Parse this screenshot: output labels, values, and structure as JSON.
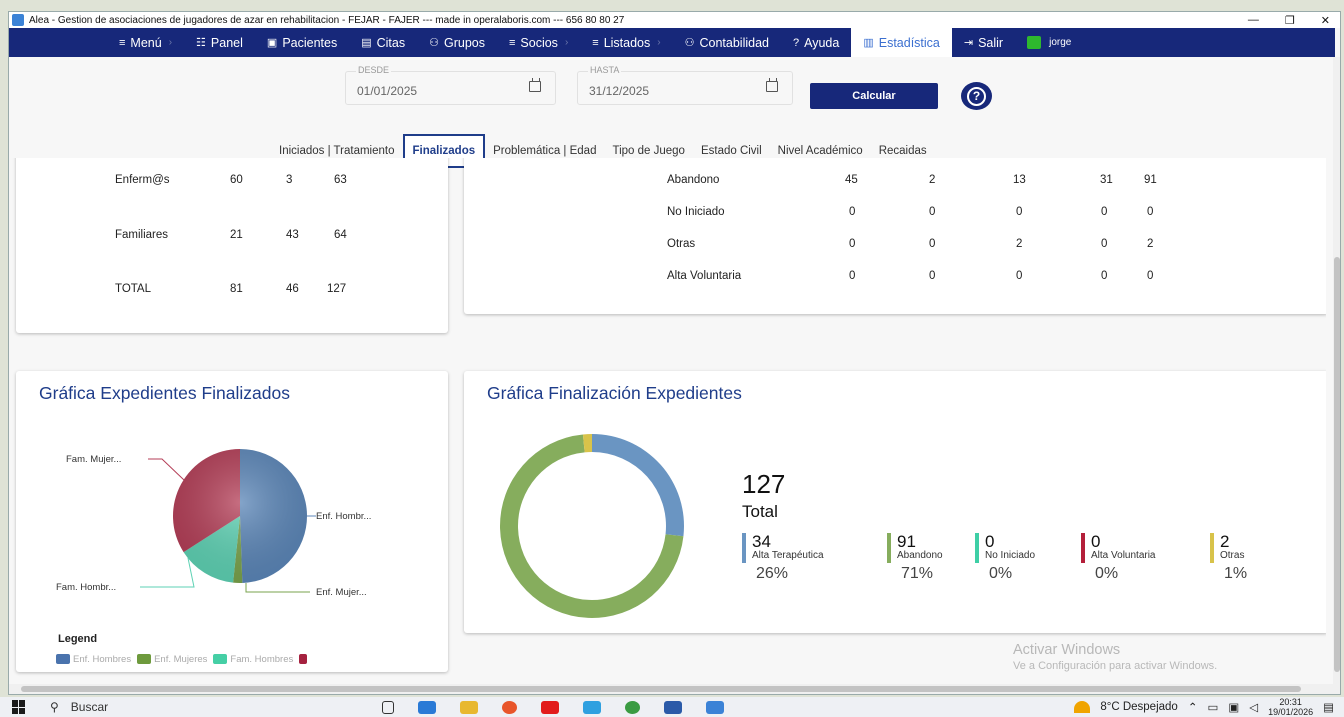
{
  "window": {
    "title": "Alea - Gestion de asociaciones de jugadores de azar en rehabilitacion - FEJAR - FAJER --- made in operalaboris.com --- 656 80 80 27",
    "controls": [
      "—",
      "❐",
      "✕"
    ]
  },
  "nav": {
    "items": [
      {
        "icon": "≡",
        "label": "Menú"
      },
      {
        "icon": "☷",
        "label": "Panel"
      },
      {
        "icon": "▣",
        "label": "Pacientes"
      },
      {
        "icon": "▤",
        "label": "Citas"
      },
      {
        "icon": "⚇",
        "label": "Grupos"
      },
      {
        "icon": "≡",
        "label": "Socios"
      },
      {
        "icon": "≡",
        "label": "Listados"
      },
      {
        "icon": "⚇",
        "label": "Contabilidad"
      },
      {
        "icon": "?",
        "label": "Ayuda"
      },
      {
        "icon": "▥",
        "label": "Estadística"
      },
      {
        "icon": "⇥",
        "label": "Salir"
      }
    ],
    "user": "jorge"
  },
  "filters": {
    "desde_label": "DESDE",
    "desde_value": "01/01/2025",
    "hasta_label": "HASTA",
    "hasta_value": "31/12/2025",
    "calc_label": "Calcular",
    "help_label": "?"
  },
  "tabs": [
    "Iniciados | Tratamiento",
    "Finalizados",
    "Problemática | Edad",
    "Tipo de Juego",
    "Estado Civil",
    "Nivel Académico",
    "Recaidas"
  ],
  "left_table": {
    "rows": [
      {
        "label": "Enferm@s",
        "a": "60",
        "b": "3",
        "c": "63"
      },
      {
        "label": "Familiares",
        "a": "21",
        "b": "43",
        "c": "64"
      },
      {
        "label": "TOTAL",
        "a": "81",
        "b": "46",
        "c": "127"
      }
    ]
  },
  "right_table": {
    "rows": [
      {
        "label": "Abandono",
        "v": [
          "45",
          "2",
          "13",
          "31",
          "91"
        ]
      },
      {
        "label": "No Iniciado",
        "v": [
          "0",
          "0",
          "0",
          "0",
          "0"
        ]
      },
      {
        "label": "Otras",
        "v": [
          "0",
          "0",
          "2",
          "0",
          "2"
        ]
      },
      {
        "label": "Alta Voluntaria",
        "v": [
          "0",
          "0",
          "0",
          "0",
          "0"
        ]
      }
    ]
  },
  "chart_data": [
    {
      "type": "pie",
      "title": "Gráfica Expedientes Finalizados",
      "categories": [
        "Enf. Hombres",
        "Enf. Mujeres",
        "Fam. Hombres",
        "Fam. Mujeres"
      ],
      "values": [
        45,
        2,
        13,
        31
      ],
      "slice_labels": [
        "Enf. Hombr...",
        "Enf. Mujer...",
        "Fam. Hombr...",
        "Fam. Mujer..."
      ],
      "colors": [
        "#5b86b8",
        "#7aa34c",
        "#5ed2b4",
        "#b43e57"
      ],
      "legend_title": "Legend",
      "legend_labels": [
        "Enf. Hombres",
        "Enf. Mujeres",
        "Fam. Hombres"
      ],
      "legend_colors": [
        "#4a73ad",
        "#6e9a3d",
        "#45cfa5",
        "#a5213f"
      ],
      "legend_position": "bottom"
    },
    {
      "type": "pie",
      "title": "Gráfica Finalización Expedientes",
      "total": "127",
      "total_label": "Total",
      "categories": [
        "Alta Terapéutica",
        "Abandono",
        "No Iniciado",
        "Alta Voluntaria",
        "Otras"
      ],
      "values": [
        34,
        91,
        0,
        0,
        2
      ],
      "percents": [
        "26%",
        "71%",
        "0%",
        "0%",
        "1%"
      ],
      "colors": [
        "#6a95c2",
        "#86ad5d",
        "#3ecfa6",
        "#b41f3a",
        "#d8c34a"
      ]
    }
  ],
  "watermark": {
    "line1": "Activar Windows",
    "line2": "Ve a Configuración para activar Windows."
  },
  "taskbar": {
    "search": "Buscar",
    "weather": "8°C  Despejado",
    "time": "20:31",
    "date": "19/01/2026"
  }
}
